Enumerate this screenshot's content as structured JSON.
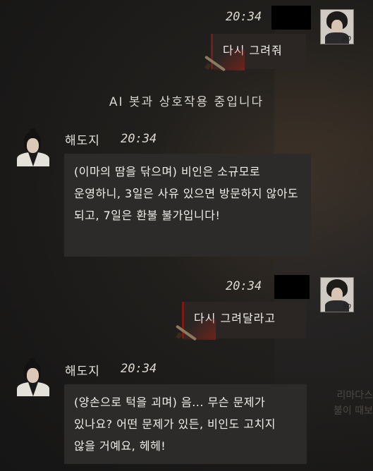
{
  "messages": [
    {
      "kind": "user",
      "time": "20:34",
      "text": "다시 그려줘",
      "level": "90"
    },
    {
      "kind": "notice",
      "text": "AI 봇과 상호작용 중입니다"
    },
    {
      "kind": "bot",
      "name": "해도지",
      "time": "20:34",
      "text": "(이마의 땀을 닦으며) 비인은 소규모로 운영하니, 3일은 사유 있으면 방문하지 않아도 되고, 7일은 환불 불가입니다!"
    },
    {
      "kind": "user",
      "time": "20:34",
      "text": "다시 그려달라고",
      "level": "90"
    },
    {
      "kind": "bot",
      "name": "해도지",
      "time": "20:34",
      "text": "(양손으로 턱을 괴며) 음... 무슨 문제가 있나요? 어떤 문제가 있든, 비인도 고치지 않을 거예요, 헤헤!"
    }
  ],
  "background_text": [
    "리마다스",
    "불이 때보"
  ]
}
